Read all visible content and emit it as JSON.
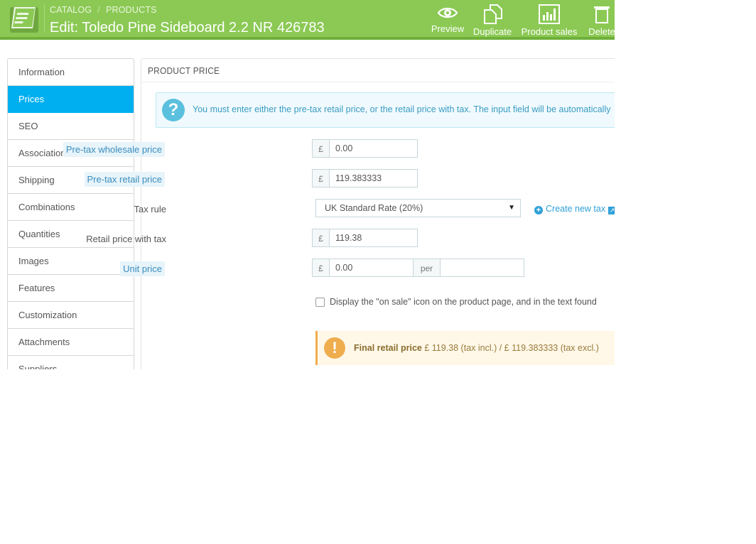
{
  "header": {
    "breadcrumb": [
      "CATALOG",
      "PRODUCTS"
    ],
    "breadcrumb_sep": "/",
    "title": "Edit: Toledo Pine Sideboard 2.2 NR 426783",
    "actions": [
      {
        "label": "Preview",
        "icon": "eye-icon"
      },
      {
        "label": "Duplicate",
        "icon": "copy-icon"
      },
      {
        "label": "Product sales",
        "icon": "bar-chart-icon"
      },
      {
        "label": "Delete",
        "icon": "trash-icon"
      }
    ],
    "colors": {
      "bar": "#8bc954",
      "bar_border": "#6fb03a"
    }
  },
  "sidebar": {
    "active_color": "#00aff0",
    "items": [
      {
        "label": "Information"
      },
      {
        "label": "Prices"
      },
      {
        "label": "SEO"
      },
      {
        "label": "Associations"
      },
      {
        "label": "Shipping"
      },
      {
        "label": "Combinations"
      },
      {
        "label": "Quantities"
      },
      {
        "label": "Images"
      },
      {
        "label": "Features"
      },
      {
        "label": "Customization"
      },
      {
        "label": "Attachments"
      },
      {
        "label": "Suppliers"
      }
    ],
    "active_index": 1
  },
  "panel": {
    "heading": "PRODUCT PRICE",
    "info": "You must enter either the pre-tax retail price, or the retail price with tax. The input field will be automatically",
    "currency": "£",
    "fields": {
      "wholesale": {
        "label": "Pre-tax wholesale price",
        "value": "0.00"
      },
      "retail": {
        "label": "Pre-tax retail price",
        "value": "119.383333"
      },
      "tax_rule": {
        "label": "Tax rule",
        "value": "UK Standard Rate (20%)"
      },
      "retail_tax": {
        "label": "Retail price with tax",
        "value": "119.38"
      },
      "unit": {
        "label": "Unit price",
        "value": "0.00",
        "per": "per",
        "per_value": ""
      }
    },
    "create_tax": "Create new tax",
    "on_sale": {
      "label": "Display the \"on sale\" icon on the product page, and in the text found",
      "checked": false
    },
    "final": {
      "label": "Final retail price",
      "text": "£ 119.38 (tax incl.) / £ 119.383333 (tax excl.)"
    }
  }
}
